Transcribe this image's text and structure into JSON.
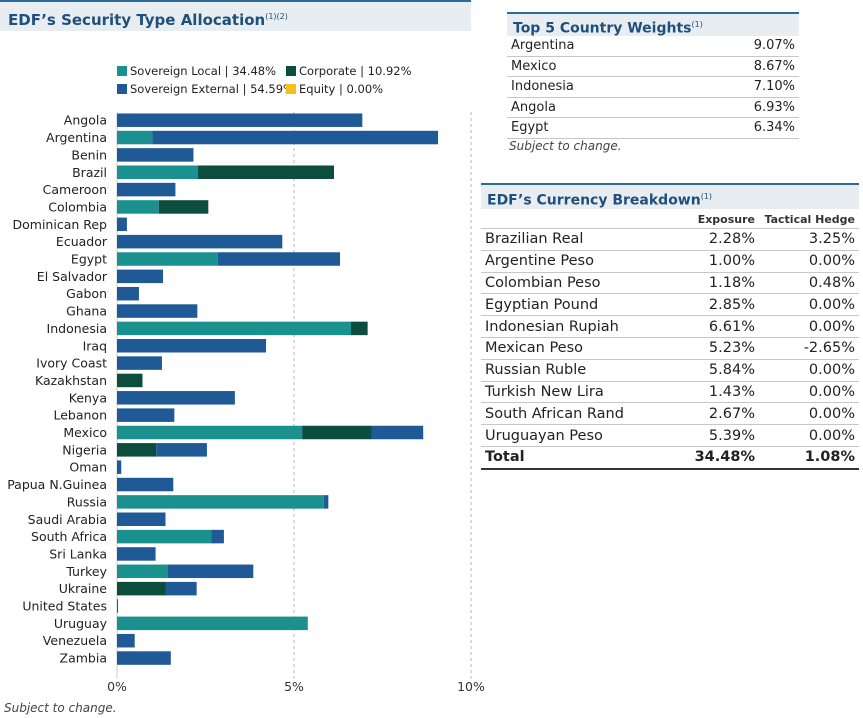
{
  "left_panel": {
    "title": "EDF’s Security Type Allocation",
    "title_sup": "(1)(2)",
    "note": "Subject to change."
  },
  "legend": [
    {
      "label": "Sovereign Local | 34.48%",
      "color": "#1a918f"
    },
    {
      "label": "Corporate | 10.92%",
      "color": "#0c4d3d"
    },
    {
      "label": "Sovereign External | 54.59%",
      "color": "#1f5a96"
    },
    {
      "label": "Equity | 0.00%",
      "color": "#f2c21b"
    }
  ],
  "chart_data": {
    "type": "bar",
    "orientation": "horizontal",
    "stacked": true,
    "categories": [
      "Angola",
      "Argentina",
      "Benin",
      "Brazil",
      "Cameroon",
      "Colombia",
      "Dominican Rep",
      "Ecuador",
      "Egypt",
      "El Salvador",
      "Gabon",
      "Ghana",
      "Indonesia",
      "Iraq",
      "Ivory Coast",
      "Kazakhstan",
      "Kenya",
      "Lebanon",
      "Mexico",
      "Nigeria",
      "Oman",
      "Papua N.Guinea",
      "Russia",
      "Saudi Arabia",
      "South Africa",
      "Sri Lanka",
      "Turkey",
      "Ukraine",
      "United States",
      "Uruguay",
      "Venezuela",
      "Zambia"
    ],
    "series": [
      {
        "name": "Sovereign Local",
        "color": "#1a918f",
        "values": [
          0,
          1.0,
          0,
          2.28,
          0,
          1.18,
          0,
          0,
          2.85,
          0,
          0,
          0,
          6.61,
          0,
          0,
          0,
          0,
          0,
          5.23,
          0,
          0,
          0,
          5.84,
          0,
          2.67,
          0,
          1.43,
          0,
          0,
          5.39,
          0,
          0
        ]
      },
      {
        "name": "Corporate",
        "color": "#0c4d3d",
        "values": [
          0,
          0,
          0,
          3.85,
          0,
          1.4,
          0,
          0,
          0,
          0,
          0,
          0,
          0.47,
          0,
          0,
          0.72,
          0,
          0,
          1.96,
          1.11,
          0,
          0,
          0,
          0,
          0,
          0,
          0,
          1.37,
          0,
          0,
          0,
          0
        ]
      },
      {
        "name": "Sovereign External",
        "color": "#1f5a96",
        "values": [
          6.93,
          8.07,
          2.16,
          0,
          1.65,
          0,
          0.28,
          4.67,
          3.45,
          1.3,
          0.62,
          2.27,
          0,
          4.21,
          1.27,
          0,
          3.33,
          1.62,
          1.46,
          1.43,
          0.12,
          1.59,
          0.13,
          1.37,
          0.35,
          1.09,
          2.42,
          0.88,
          0.03,
          0,
          0.5,
          1.52
        ]
      },
      {
        "name": "Equity",
        "color": "#f2c21b",
        "values": [
          0,
          0,
          0,
          0,
          0,
          0,
          0,
          0,
          0,
          0,
          0,
          0,
          0,
          0,
          0,
          0,
          0,
          0,
          0,
          0,
          0,
          0,
          0,
          0,
          0,
          0,
          0,
          0,
          0,
          0,
          0,
          0
        ]
      }
    ],
    "xlim": [
      0,
      10
    ],
    "x_ticks": [
      "0%",
      "5%",
      "10%"
    ],
    "x_tick_values": [
      0,
      5,
      10
    ],
    "grid": "vertical dashed"
  },
  "top5": {
    "title": "Top 5 Country Weights",
    "title_sup": "(1)",
    "rows": [
      {
        "country": "Argentina",
        "value": "9.07%"
      },
      {
        "country": "Mexico",
        "value": "8.67%"
      },
      {
        "country": "Indonesia",
        "value": "7.10%"
      },
      {
        "country": "Angola",
        "value": "6.93%"
      },
      {
        "country": "Egypt",
        "value": "6.34%"
      }
    ],
    "note": "Subject to change."
  },
  "currency": {
    "title": "EDF’s Currency Breakdown",
    "title_sup": "(1)",
    "headers": [
      "",
      "Exposure",
      "Tactical Hedge"
    ],
    "rows": [
      {
        "name": "Brazilian Real",
        "exposure": "2.28%",
        "hedge": "3.25%"
      },
      {
        "name": "Argentine Peso",
        "exposure": "1.00%",
        "hedge": "0.00%"
      },
      {
        "name": "Colombian Peso",
        "exposure": "1.18%",
        "hedge": "0.48%"
      },
      {
        "name": "Egyptian Pound",
        "exposure": "2.85%",
        "hedge": "0.00%"
      },
      {
        "name": "Indonesian Rupiah",
        "exposure": "6.61%",
        "hedge": "0.00%"
      },
      {
        "name": "Mexican Peso",
        "exposure": "5.23%",
        "hedge": "-2.65%"
      },
      {
        "name": "Russian Ruble",
        "exposure": "5.84%",
        "hedge": "0.00%"
      },
      {
        "name": "Turkish New Lira",
        "exposure": "1.43%",
        "hedge": "0.00%"
      },
      {
        "name": "South African Rand",
        "exposure": "2.67%",
        "hedge": "0.00%"
      },
      {
        "name": "Uruguayan Peso",
        "exposure": "5.39%",
        "hedge": "0.00%"
      }
    ],
    "total": {
      "name": "Total",
      "exposure": "34.48%",
      "hedge": "1.08%"
    }
  }
}
